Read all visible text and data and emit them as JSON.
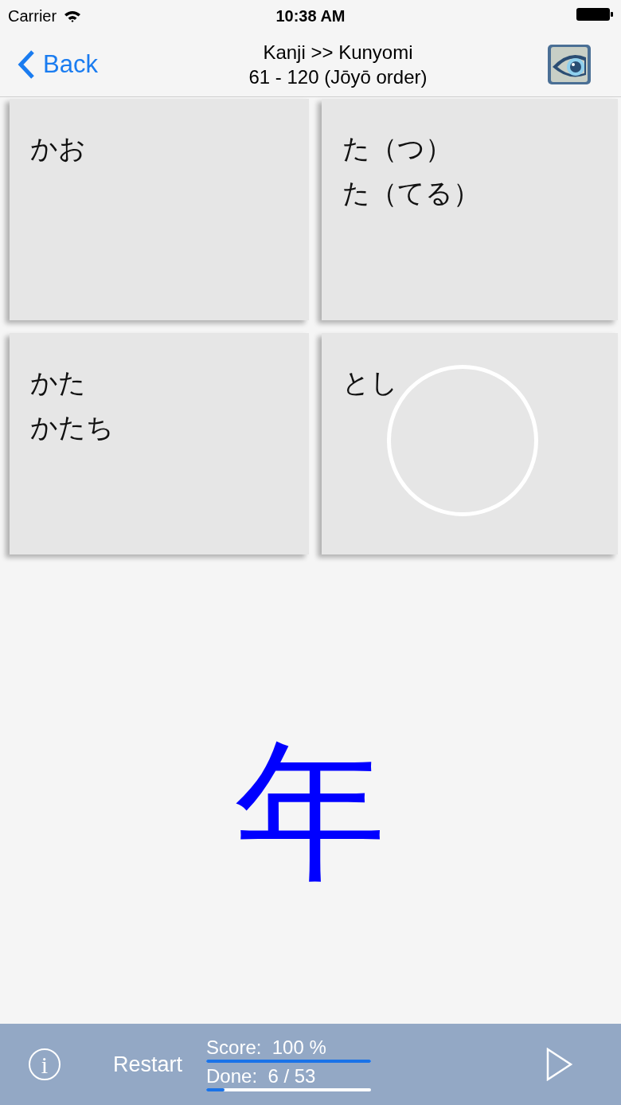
{
  "status_bar": {
    "carrier": "Carrier",
    "time": "10:38 AM"
  },
  "nav": {
    "back": "Back",
    "title": "Kanji >> Kunyomi",
    "subtitle": "61 - 120 (Jōyō order)"
  },
  "answers": [
    {
      "lines": [
        "かお"
      ],
      "touched": false
    },
    {
      "lines": [
        "た（つ）",
        "た（てる）"
      ],
      "touched": false
    },
    {
      "lines": [
        "かた",
        "かたち"
      ],
      "touched": false
    },
    {
      "lines": [
        "とし"
      ],
      "touched": true
    }
  ],
  "question": "年",
  "toolbar": {
    "info": "i",
    "restart": "Restart",
    "score": "Score:  100 %",
    "score_bar": {
      "level": 1
    },
    "done": "Done:  6 / 53",
    "done_bar": {
      "level": 0.113
    }
  }
}
